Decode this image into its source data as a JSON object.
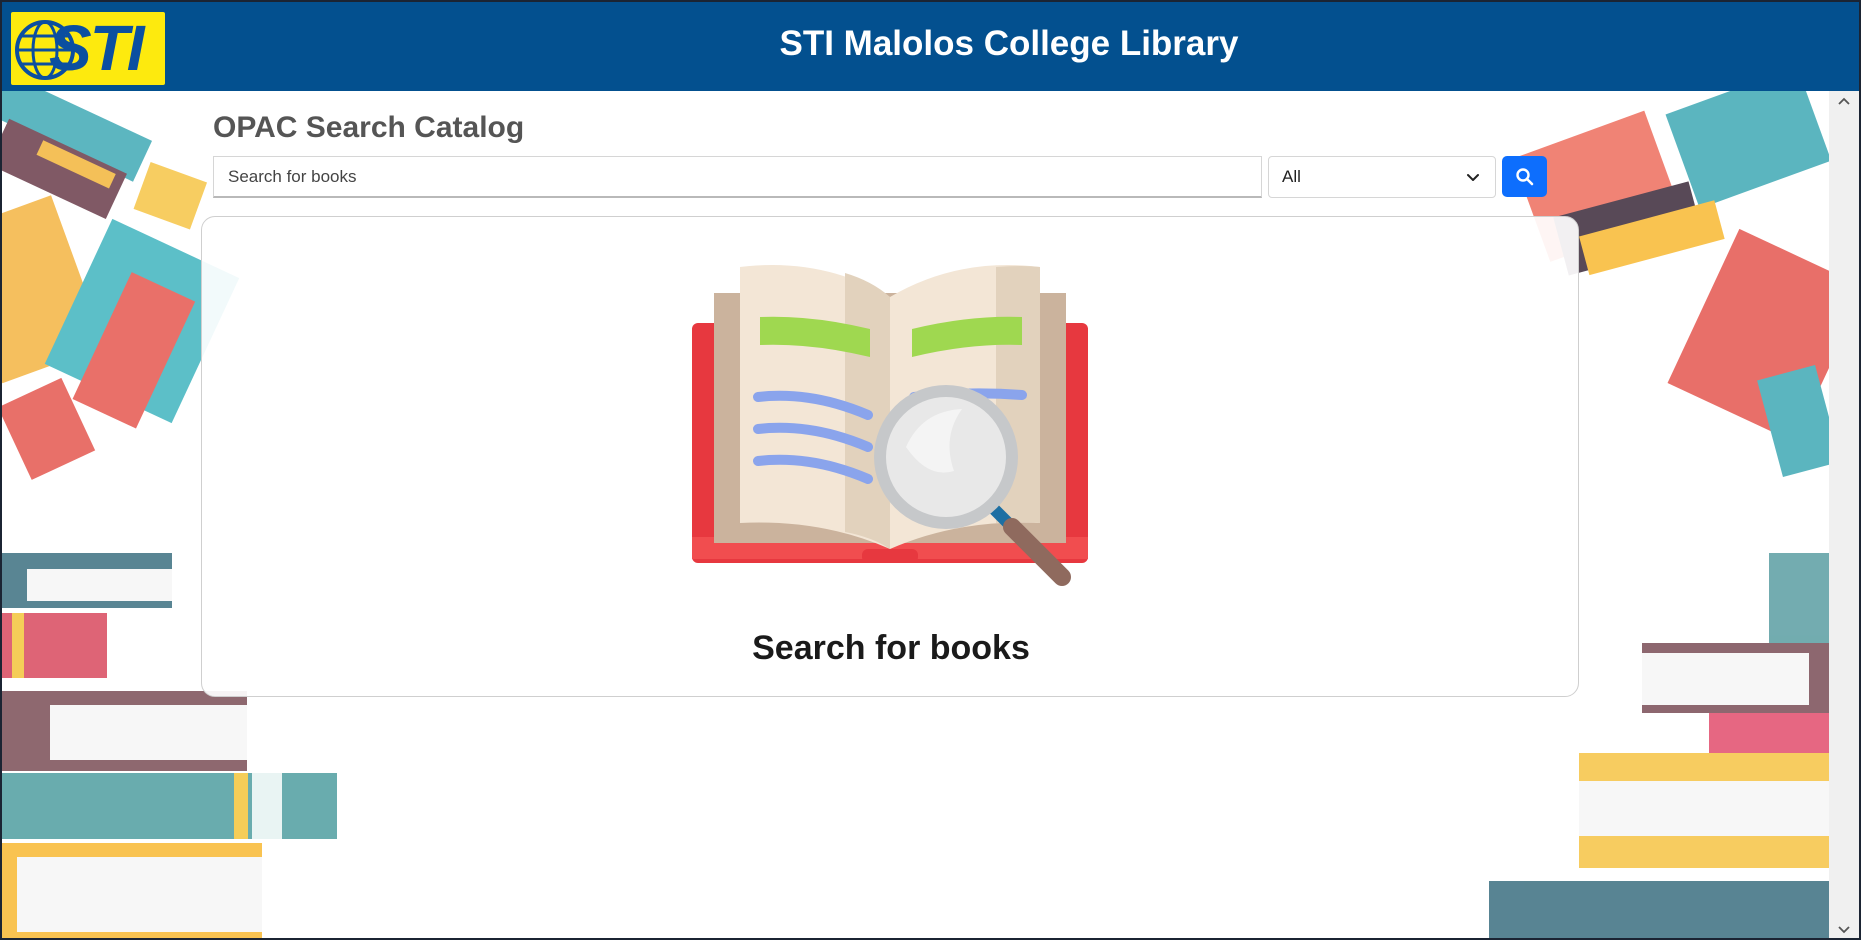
{
  "header": {
    "logo_text": "STI",
    "title": "STI Malolos College Library"
  },
  "search": {
    "heading": "OPAC Search Catalog",
    "placeholder": "Search for books",
    "filter_selected": "All"
  },
  "results": {
    "empty_message": "Search for books"
  },
  "colors": {
    "header_bg": "#03508f",
    "logo_bg": "#fdea0e",
    "button_bg": "#0d6efd"
  },
  "icons": {
    "search_button": "search-icon",
    "filter": "chevron-down-icon",
    "illustration": "open-book-magnifier-icon"
  }
}
